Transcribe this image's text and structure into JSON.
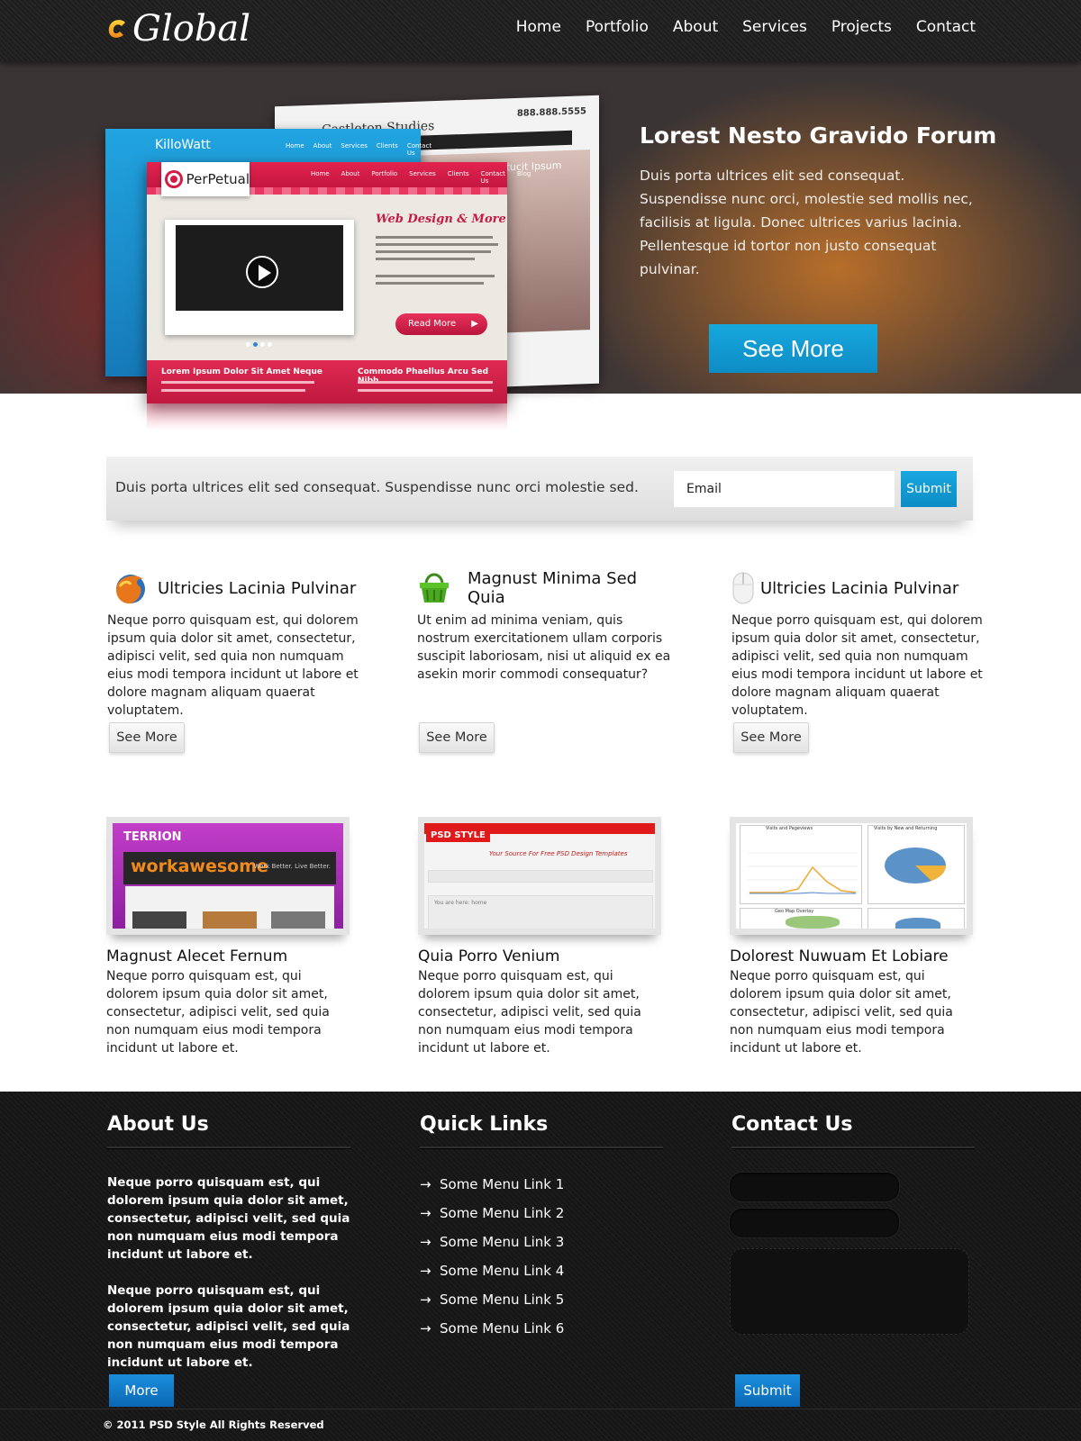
{
  "header": {
    "logo_text": "Global",
    "nav": [
      "Home",
      "Portfolio",
      "About",
      "Services",
      "Projects",
      "Contact"
    ]
  },
  "hero": {
    "title": "Lorest Nesto Gravido Forum",
    "text": "Duis porta ultrices elit sed consequat. Suspendisse nunc orci, molestie sed mollis nec, facilisis at ligula. Donec ultrices varius lacinia. Pellentesque id tortor non justo consequat pulvinar.",
    "button": "See More",
    "mockups": {
      "back_name": "Castleton Studies",
      "back_phone": "888.888.5555",
      "back_panel_text": "es Altucit Ipsum",
      "left_name": "KilloWatt",
      "left_nav": [
        "Home",
        "About",
        "Services",
        "Clients",
        "Contact Us"
      ],
      "front_name": "PerPetual",
      "front_nav": [
        "Home",
        "About",
        "Portfolio",
        "Services",
        "Clients",
        "Contact Us",
        "Blog"
      ],
      "front_heading": "Web Design & More",
      "front_read_more": "Read More",
      "front_bottom_1": "Lorem Ipsum Dolor Sit Amet Neque",
      "front_bottom_2": "Commodo Phaellus Arcu Sed Nibh"
    }
  },
  "newsletter": {
    "text": "Duis porta ultrices elit sed consequat. Suspendisse nunc orci molestie sed.",
    "email_placeholder": "Email",
    "submit": "Submit"
  },
  "features": [
    {
      "title": "Ultricies Lacinia Pulvinar",
      "icon": "firefox-icon",
      "body": "Neque porro quisquam est, qui dolorem ipsum quia dolor sit amet, consectetur, adipisci velit, sed quia non numquam eius modi tempora incidunt ut labore et dolore magnam aliquam quaerat voluptatem.",
      "button": "See More"
    },
    {
      "title": "Magnust Minima Sed Quia",
      "icon": "basket-icon",
      "body": "Ut enim ad minima veniam, quis nostrum exercitationem ullam corporis suscipit laboriosam, nisi ut aliquid ex ea asekin morir commodi consequatur?",
      "button": "See More"
    },
    {
      "title": "Ultricies Lacinia Pulvinar",
      "icon": "mouse-icon",
      "body": "Neque porro quisquam est, qui dolorem ipsum quia dolor sit amet, consectetur, adipisci velit, sed quia non numquam eius modi tempora incidunt ut labore et dolore magnam aliquam quaerat voluptatem.",
      "button": "See More"
    }
  ],
  "portfolio": [
    {
      "title": "Magnust Alecet Fernum",
      "thumb_label": "TERRION",
      "thumb_headline": "workawesome",
      "thumb_tagline": "Work Better. Live Better.",
      "body": "Neque porro quisquam est, qui dolorem ipsum quia dolor sit amet, consectetur, adipisci velit, sed quia non numquam eius modi tempora incidunt ut labore et."
    },
    {
      "title": "Quia Porro Venium",
      "thumb_label": "PSD STYLE",
      "thumb_headline": "Your Source For Free PSD Design Templates",
      "thumb_tagline": "You are here: home",
      "body": "Neque porro quisquam est, qui dolorem ipsum quia dolor sit amet, consectetur, adipisci velit, sed quia non numquam eius modi tempora incidunt ut labore et."
    },
    {
      "title": "Dolorest Nuwuam Et Lobiare",
      "thumb_label": "Visits and Pageviews",
      "thumb_headline": "Visits by New and Returning",
      "thumb_tagline": "Geo Map Overlay",
      "body": "Neque porro quisquam est, qui dolorem ipsum quia dolor sit amet, consectetur, adipisci velit, sed quia non numquam eius modi tempora incidunt ut labore et."
    }
  ],
  "footer": {
    "about": {
      "title": "About Us",
      "p1": "Neque porro quisquam est, qui dolorem ipsum quia dolor sit amet, consectetur, adipisci velit, sed quia non numquam eius modi tempora incidunt ut labore et.",
      "p2": "Neque porro quisquam est, qui dolorem ipsum quia dolor sit amet, consectetur, adipisci velit, sed quia non numquam eius modi tempora incidunt ut labore et.",
      "button": "More"
    },
    "links": {
      "title": "Quick Links",
      "items": [
        "Some Menu Link 1",
        "Some Menu Link 2",
        "Some Menu Link 3",
        "Some Menu Link 4",
        "Some Menu Link 5",
        "Some Menu Link 6"
      ]
    },
    "contact": {
      "title": "Contact Us",
      "button": "Submit"
    },
    "copyright": "© 2011 PSD Style All Rights Reserved"
  },
  "colors": {
    "accent_blue": "#14a0d8",
    "footer_blue": "#1480cc",
    "mockup_red": "#d61a44",
    "logo_orange": "#f5a623"
  }
}
